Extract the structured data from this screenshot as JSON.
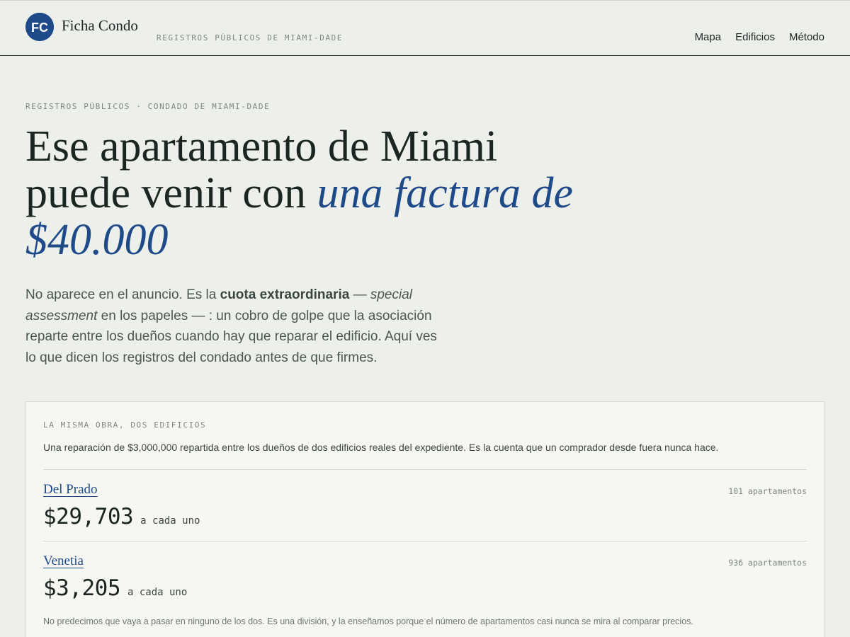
{
  "header": {
    "logo_text": "FC",
    "brand_name": "Ficha Condo",
    "brand_tagline": "REGISTROS PÚBLICOS DE MIAMI-DADE",
    "nav": [
      "Mapa",
      "Edificios",
      "Método"
    ],
    "accent_color": "#1f4a8a"
  },
  "hero": {
    "eyebrow": "REGISTROS PÚBLICOS · CONDADO DE MIAMI-DADE",
    "headline_line1": "Ese apartamento de Miami",
    "headline_line2_plain": "puede venir con ",
    "headline_accent_1": "una factura de",
    "headline_accent_2": "$40.000",
    "lead_1": "No aparece en el anuncio. Es la ",
    "lead_bold": "cuota extraordinaria",
    "lead_2": " — ",
    "lead_italic": "special assessment",
    "lead_3": " en los papeles — : un cobro de golpe que la asociación reparte entre los dueños cuando hay que reparar el edificio. Aquí ves lo que dicen los registros del condado antes de que firmes."
  },
  "comparison": {
    "label": "LA MISMA OBRA, DOS EDIFICIOS",
    "description": "Una reparación de $3,000,000 repartida entre los dueños de dos edificios reales del expediente. Es la cuenta que un comprador desde fuera nunca hace.",
    "buildings": [
      {
        "name": "Del Prado",
        "units": "101 apartamentos",
        "amount": "$29,703",
        "suffix": "a cada uno"
      },
      {
        "name": "Venetia",
        "units": "936 apartamentos",
        "amount": "$3,205",
        "suffix": "a cada uno"
      }
    ],
    "note": "No predecimos que vaya a pasar en ninguno de los dos. Es una división, y la enseñamos porque el número de apartamentos casi nunca se mira al comparar precios."
  }
}
